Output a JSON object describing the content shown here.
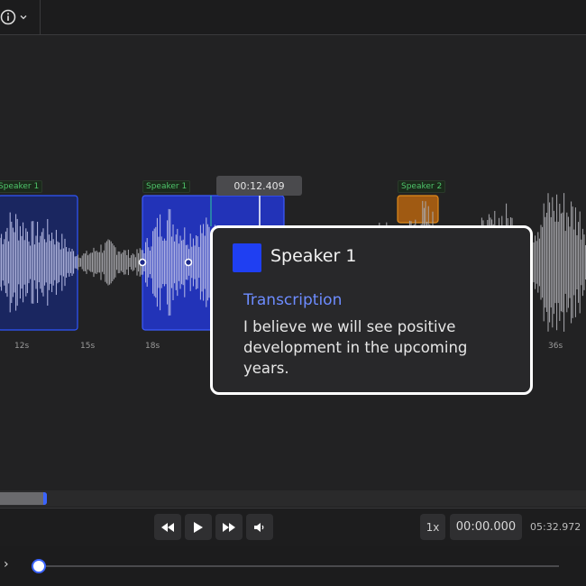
{
  "toolbar": {
    "info_icon": "info-icon",
    "chevron_icon": "chevron-down-icon"
  },
  "waveform": {
    "segments": [
      {
        "label": "Speaker 1",
        "color": "#2a47d8"
      },
      {
        "label": "Speaker 1",
        "color": "#2a47d8"
      },
      {
        "label": "Speaker 2",
        "color": "#e08a1a"
      }
    ],
    "playhead_time": "00:12.409",
    "ticks": [
      "12s",
      "15s",
      "18s",
      "36s"
    ]
  },
  "popup": {
    "speaker": "Speaker 1",
    "swatch_color": "#1f3ff2",
    "transcription_title": "Transcription",
    "transcription_text": "I believe we will see positive development in the upcoming years."
  },
  "controls": {
    "rewind_icon": "rewind-icon",
    "play_icon": "play-icon",
    "forward_icon": "fast-forward-icon",
    "volume_icon": "volume-icon",
    "rate": "1x",
    "current_time": "00:00.000",
    "total_time": "05:32.972"
  },
  "bottom": {
    "expand_icon": "chevron-right-icon"
  }
}
